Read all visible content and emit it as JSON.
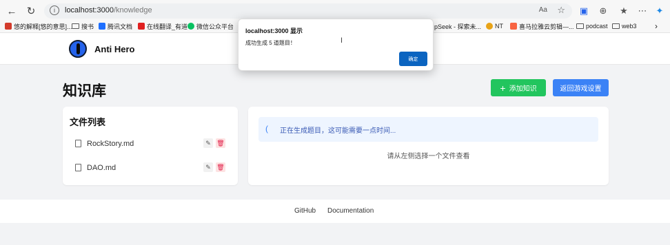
{
  "browser": {
    "url_host": "localhost:3000",
    "url_path": "/knowledge",
    "reader_label": "Aa",
    "icons": {
      "back": "arrow-left-icon",
      "reload": "reload-icon",
      "info": "info-icon",
      "star": "star-icon",
      "extensions": "extensions-icon",
      "favorites": "favorites-icon",
      "menu": "more-icon",
      "copilot": "copilot-icon"
    },
    "bookmarks": [
      {
        "label": "悠的解释[悠的意思]...",
        "color": "#d33b2c",
        "kind": "site"
      },
      {
        "label": "搜书",
        "color": "#666666",
        "kind": "folder"
      },
      {
        "label": "腾讯文档",
        "color": "#1e6fff",
        "kind": "site"
      },
      {
        "label": "在线翻译_有道",
        "color": "#e02020",
        "kind": "site"
      },
      {
        "label": "微信公众平台",
        "color": "#07c160",
        "kind": "site"
      },
      {
        "label": "pSeek - 探索未...",
        "color": "#4d6bfe",
        "kind": "site"
      },
      {
        "label": "NT",
        "color": "#e8a317",
        "kind": "site"
      },
      {
        "label": "喜马拉雅云剪辑—...",
        "color": "#f86442",
        "kind": "site"
      },
      {
        "label": "podcast",
        "color": "#666666",
        "kind": "folder"
      },
      {
        "label": "web3",
        "color": "#666666",
        "kind": "folder"
      }
    ]
  },
  "app": {
    "title": "Anti Hero"
  },
  "page": {
    "title": "知识库",
    "add_button": "添加知识",
    "back_button": "返回游戏设置"
  },
  "files": {
    "title": "文件列表",
    "items": [
      {
        "name": "RockStory.md"
      },
      {
        "name": "DAO.md"
      }
    ]
  },
  "viewer": {
    "status": "正在生成题目，这可能需要一点时间...",
    "hint": "请从左侧选择一个文件查看"
  },
  "footer": {
    "links": [
      "GitHub",
      "Documentation"
    ]
  },
  "dialog": {
    "title": "localhost:3000 显示",
    "message": "成功生成 5 道题目！",
    "ok": "确定"
  },
  "colors": {
    "green": "#22c55e",
    "blue": "#3b82f6",
    "dialog_button": "#0b64c0",
    "danger": "#e11d48"
  }
}
